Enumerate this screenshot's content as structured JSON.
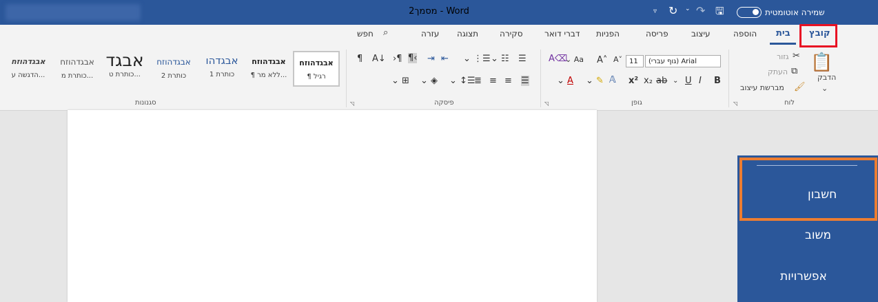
{
  "titlebar": {
    "title": "מסמך2 - Word",
    "autosave_label": "שמירה אוטומטית",
    "save_icon": "save-icon",
    "undo_icon": "undo-icon",
    "redo_icon": "redo-icon",
    "customize_icon": "customize-qat-icon"
  },
  "tabs": [
    {
      "label": "קובץ"
    },
    {
      "label": "בית"
    },
    {
      "label": "הוספה"
    },
    {
      "label": "עיצוב"
    },
    {
      "label": "פריסה"
    },
    {
      "label": "הפניות"
    },
    {
      "label": "דברי דואר"
    },
    {
      "label": "סקירה"
    },
    {
      "label": "תצוגה"
    },
    {
      "label": "עזרה"
    },
    {
      "label": "חפש"
    }
  ],
  "clipboard": {
    "group_label": "לוח",
    "paste": "הדבק",
    "cut": "גזור",
    "copy": "העתק",
    "format_painter": "מברשת עיצוב"
  },
  "font": {
    "group_label": "גופן",
    "font_name": "(גוף עברי) Arial",
    "font_size": "11"
  },
  "paragraph": {
    "group_label": "פיסקה"
  },
  "styles": {
    "group_label": "סגנונות",
    "items": [
      {
        "preview": "אבגדהוזח",
        "label": "¶ רגיל"
      },
      {
        "preview": "אבגדהוזח",
        "label": "¶ ללא מר..."
      },
      {
        "preview": "אבגדהו",
        "label": "כותרת 1"
      },
      {
        "preview": "אבגדהוזח",
        "label": "כותרת 2"
      },
      {
        "preview": "אבגד",
        "label": "כותרת ט..."
      },
      {
        "preview": "אבגדהוזח",
        "label": "כותרת מ..."
      },
      {
        "preview": "אבגדהוזח",
        "label": "הדגשה ע..."
      }
    ]
  },
  "file_menu": {
    "items": [
      {
        "label": "חשבון"
      },
      {
        "label": "משוב"
      },
      {
        "label": "אפשרויות"
      }
    ]
  },
  "colors": {
    "word_blue": "#2b579a",
    "highlight_red": "#e81123",
    "highlight_orange": "#ed7d31"
  }
}
